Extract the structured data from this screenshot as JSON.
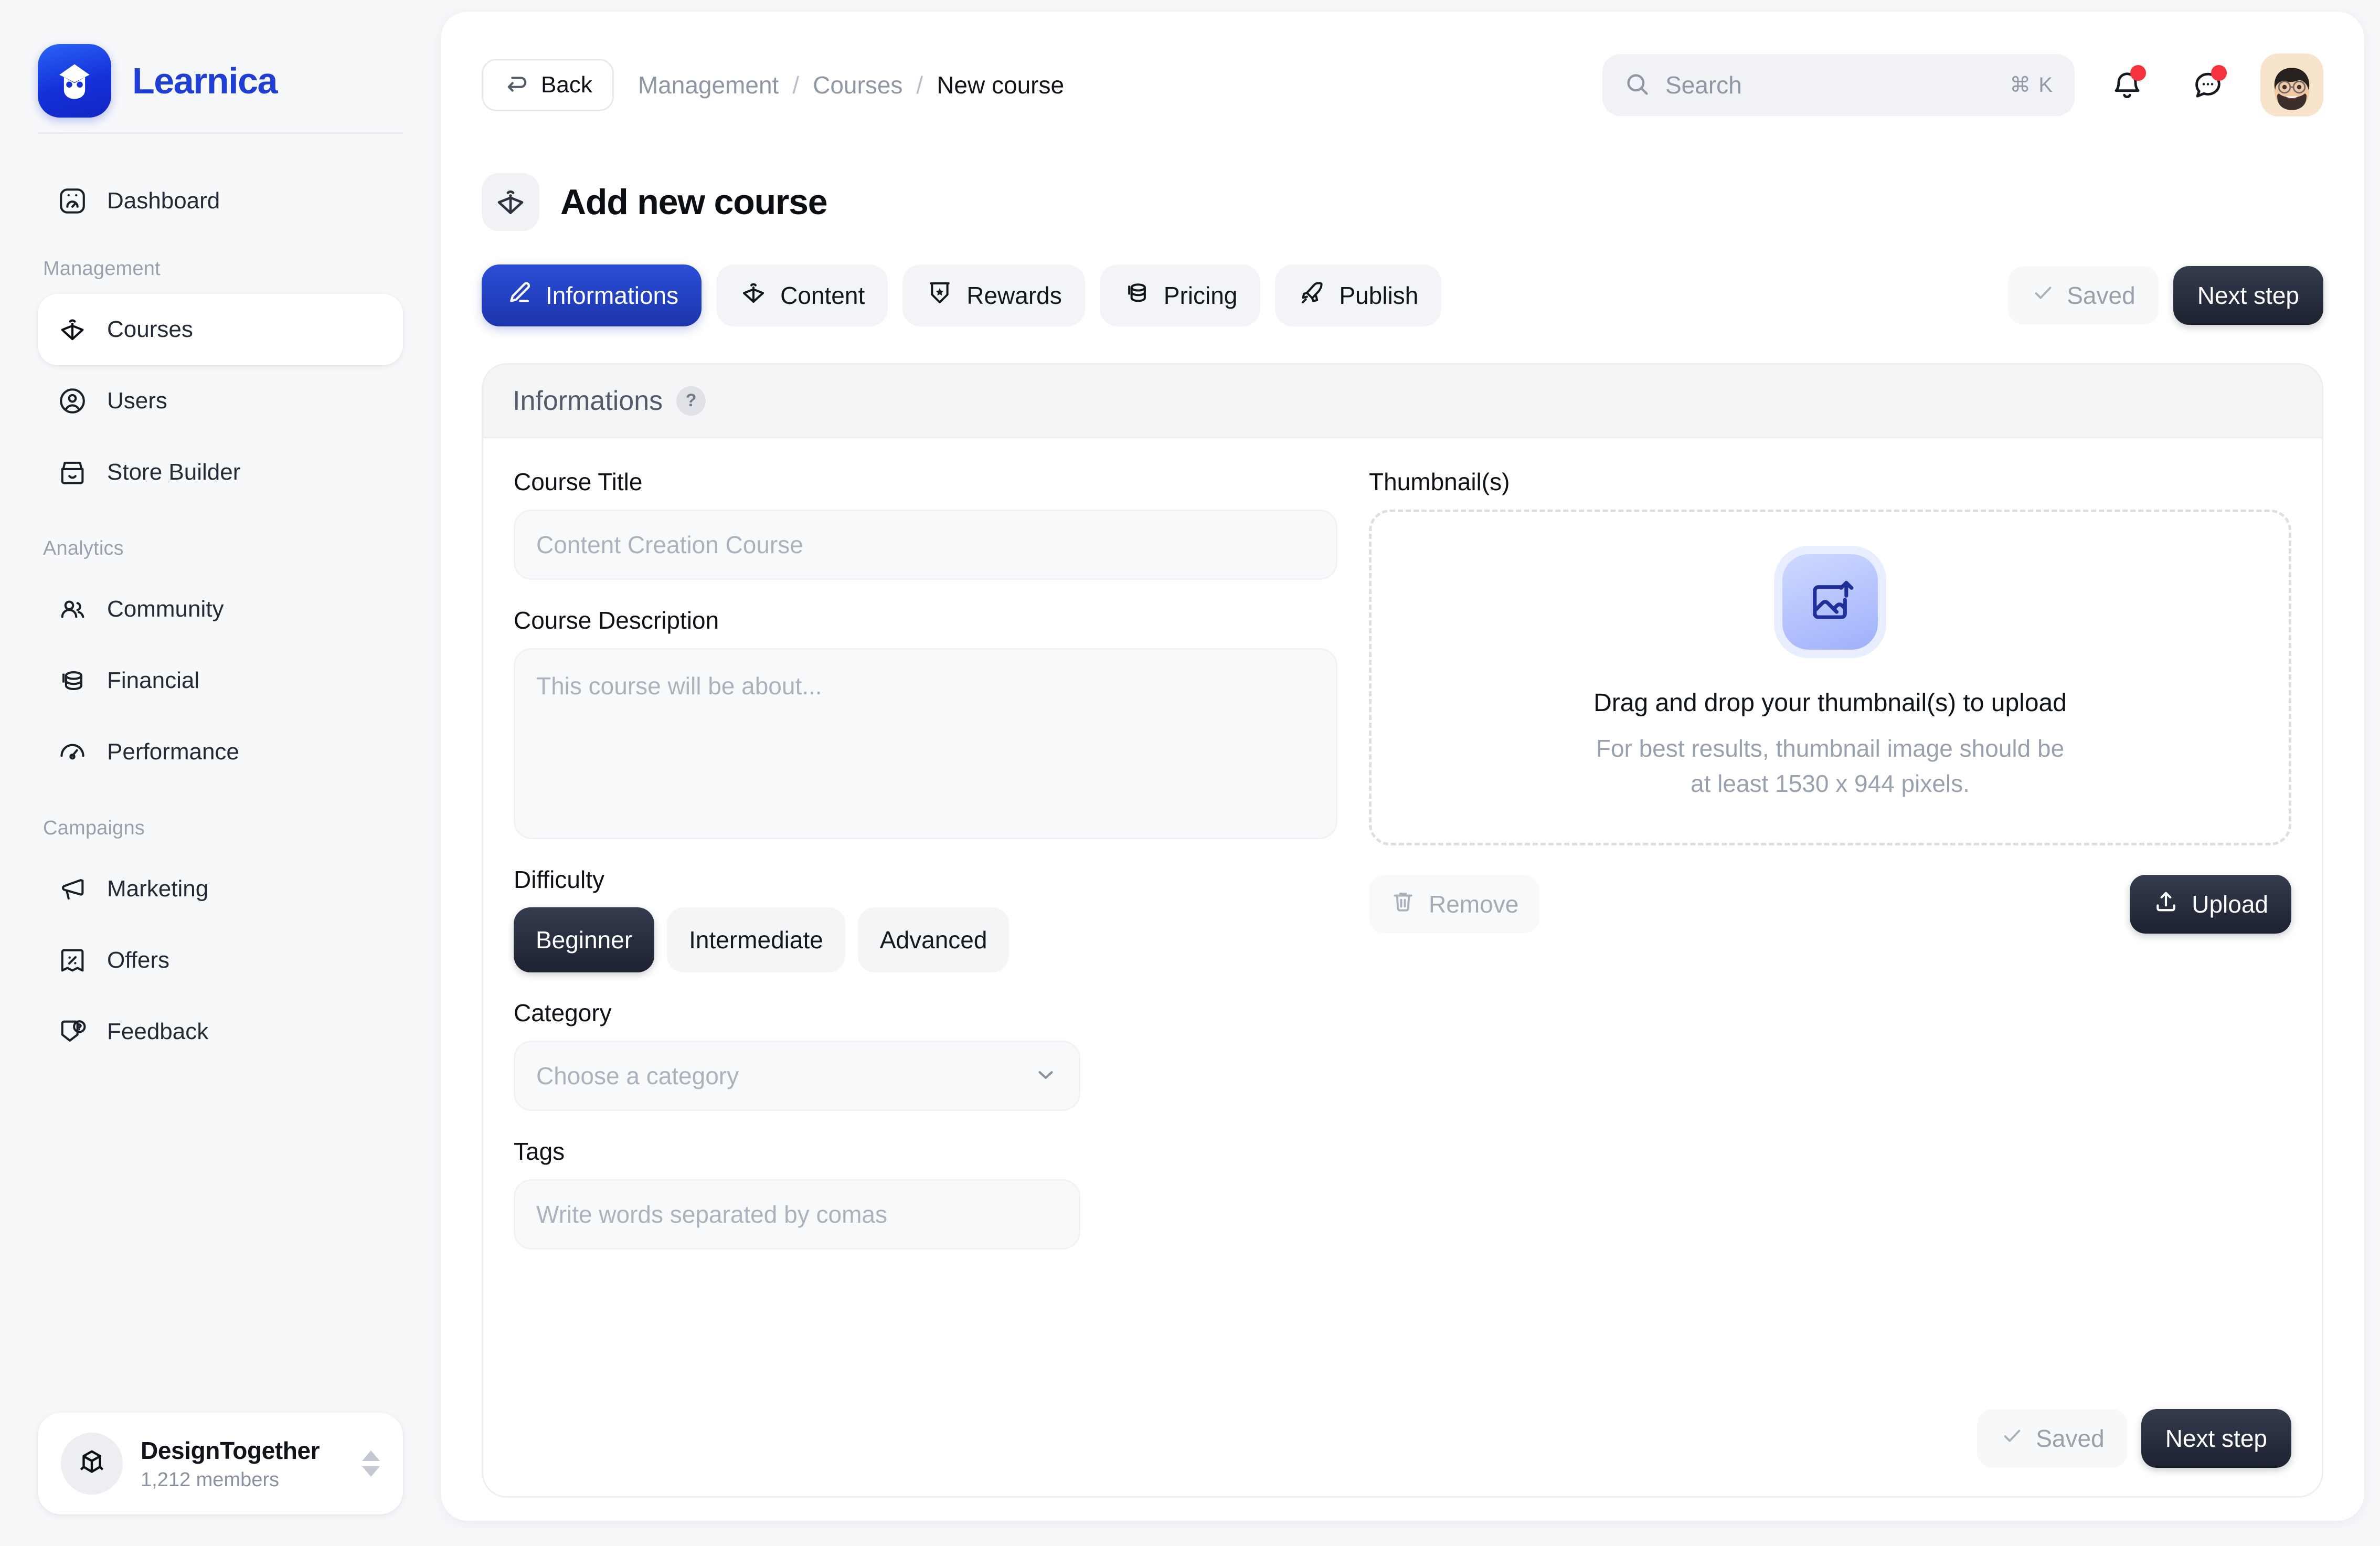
{
  "brand": {
    "name": "Learnica",
    "logo_icon": "learnica-owl-logo"
  },
  "sidebar": {
    "groups": [
      {
        "label": "",
        "items": [
          {
            "label": "Dashboard",
            "icon": "dashboard-icon",
            "active": false
          }
        ]
      },
      {
        "label": "Management",
        "items": [
          {
            "label": "Courses",
            "icon": "book-icon",
            "active": true
          },
          {
            "label": "Users",
            "icon": "user-circle-icon",
            "active": false
          },
          {
            "label": "Store Builder",
            "icon": "store-icon",
            "active": false
          }
        ]
      },
      {
        "label": "Analytics",
        "items": [
          {
            "label": "Community",
            "icon": "users-group-icon",
            "active": false
          },
          {
            "label": "Financial",
            "icon": "coins-stack-icon",
            "active": false
          },
          {
            "label": "Performance",
            "icon": "gauge-icon",
            "active": false
          }
        ]
      },
      {
        "label": "Campaigns",
        "items": [
          {
            "label": "Marketing",
            "icon": "megaphone-icon",
            "active": false
          },
          {
            "label": "Offers",
            "icon": "discount-tag-icon",
            "active": false
          },
          {
            "label": "Feedback",
            "icon": "feedback-question-icon",
            "active": false
          }
        ]
      }
    ],
    "workspace": {
      "name": "DesignTogether",
      "members": "1,212 members",
      "icon": "cube-icon"
    }
  },
  "topbar": {
    "back_label": "Back",
    "back_icon": "undo-arrow-icon",
    "breadcrumb": [
      {
        "label": "Management",
        "current": false
      },
      {
        "label": "Courses",
        "current": false
      },
      {
        "label": "New course",
        "current": true
      }
    ],
    "breadcrumb_separator": "/",
    "search": {
      "placeholder": "Search",
      "shortcut": "⌘ K",
      "icon": "search-icon"
    },
    "notifications_icon": "bell-icon",
    "messages_icon": "chat-bubble-icon",
    "avatar_icon": "user-avatar"
  },
  "page": {
    "title": "Add new course",
    "title_icon": "book-icon"
  },
  "tabs": [
    {
      "label": "Informations",
      "icon": "pencil-icon",
      "active": true
    },
    {
      "label": "Content",
      "icon": "book-icon",
      "active": false
    },
    {
      "label": "Rewards",
      "icon": "badge-star-icon",
      "active": false
    },
    {
      "label": "Pricing",
      "icon": "coins-stack-icon",
      "active": false
    },
    {
      "label": "Publish",
      "icon": "rocket-icon",
      "active": false
    }
  ],
  "actions": {
    "saved_label": "Saved",
    "saved_icon": "check-icon",
    "next_label": "Next step"
  },
  "card": {
    "header_title": "Informations",
    "help_glyph": "?",
    "fields": {
      "course_title": {
        "label": "Course Title",
        "value": "",
        "placeholder": "Content Creation Course"
      },
      "course_description": {
        "label": "Course Description",
        "value": "",
        "placeholder": "This course will be about..."
      },
      "difficulty": {
        "label": "Difficulty",
        "options": [
          "Beginner",
          "Intermediate",
          "Advanced"
        ],
        "selected": "Beginner"
      },
      "category": {
        "label": "Category",
        "value": "",
        "placeholder": "Choose a category",
        "chevron_icon": "chevron-down-icon"
      },
      "tags": {
        "label": "Tags",
        "value": "",
        "placeholder": "Write words separated by comas"
      }
    },
    "thumbnail": {
      "label": "Thumbnail(s)",
      "dropzone_icon": "image-upload-icon",
      "title": "Drag and drop your thumbnail(s) to upload",
      "sub_line1": "For best results, thumbnail image should be",
      "sub_line2": "at least 1530 x 944 pixels.",
      "remove_label": "Remove",
      "remove_icon": "trash-icon",
      "upload_label": "Upload",
      "upload_icon": "upload-icon"
    }
  },
  "colors": {
    "brand_blue": "#1f3fd4",
    "tab_active": "#2443c8",
    "dark_button": "#1d2230",
    "page_bg": "#f7f8fa",
    "notification_dot": "#f5333f"
  }
}
